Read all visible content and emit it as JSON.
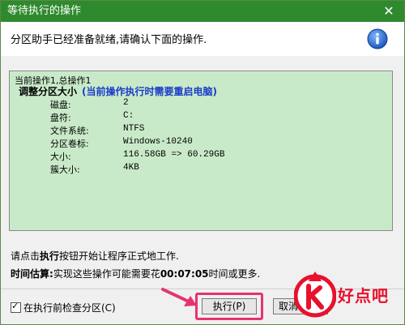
{
  "window": {
    "title": "等待执行的操作",
    "close_glyph": "✕"
  },
  "header": {
    "text": "分区助手已经准备就绪,请确认下面的操作."
  },
  "operations": {
    "summary": "当前操作1,总操作1",
    "operation_title": "调整分区大小",
    "operation_note": "(当前操作执行时需要重启电脑)",
    "details": [
      {
        "label": "磁盘:",
        "value": "2"
      },
      {
        "label": "盘符:",
        "value": "C:"
      },
      {
        "label": "文件系统:",
        "value": "NTFS"
      },
      {
        "label": "分区卷标:",
        "value": "Windows-10240"
      },
      {
        "label": "大小:",
        "value": "116.58GB => 60.29GB"
      },
      {
        "label": "簇大小:",
        "value": "4KB"
      }
    ]
  },
  "instruction": {
    "prefix": "请点击",
    "bold": "执行",
    "suffix": "按钮开始让程序正式地工作."
  },
  "estimate": {
    "label": "时间估算:",
    "prefix": "实现这些操作可能需要花",
    "time": "00:07:05",
    "suffix": "时间或更多."
  },
  "footer": {
    "precheck_label": "在执行前检查分区(C)",
    "precheck_checked": true,
    "precheck_mark": "✓",
    "execute_label": "执行(P)",
    "cancel_label": "取消"
  },
  "watermark": {
    "text": "好点吧"
  },
  "colors": {
    "titlebar": "#2f8a2e",
    "list_bg": "#c9eac9",
    "note_blue": "#1a3cc8",
    "highlight": "#e4346f",
    "watermark_red": "#e8112d"
  },
  "icons": {
    "info": "info-icon",
    "close": "close-icon",
    "arrow": "arrow-icon",
    "checkbox": "checkbox"
  }
}
